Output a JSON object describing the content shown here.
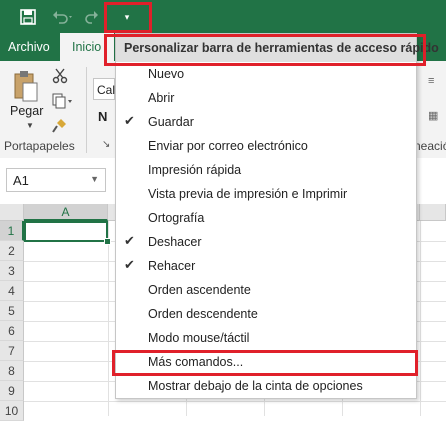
{
  "qat": {
    "save_icon": "save-icon",
    "undo_icon": "undo-icon",
    "redo_icon": "redo-icon",
    "customize_icon": "customize-qat-icon",
    "customize_glyph": "▾"
  },
  "tabs": {
    "archivo": "Archivo",
    "inicio": "Inicio"
  },
  "ribbon": {
    "paste_label": "Pegar",
    "clipboard_group": "Portapapeles",
    "font_box": "Cal",
    "bold": "N",
    "right_group_partial": "neació"
  },
  "formula": {
    "name_box": "A1"
  },
  "grid": {
    "columns": [
      "A",
      "",
      "",
      "",
      "",
      ""
    ],
    "rows": [
      "1",
      "2",
      "3",
      "4",
      "5",
      "6",
      "7",
      "8",
      "9",
      "10"
    ]
  },
  "menu": {
    "title": "Personalizar barra de herramientas de acceso rápido",
    "items": [
      {
        "label": "Nuevo",
        "checked": false
      },
      {
        "label": "Abrir",
        "checked": false
      },
      {
        "label": "Guardar",
        "checked": true
      },
      {
        "label": "Enviar por correo electrónico",
        "checked": false
      },
      {
        "label": "Impresión rápida",
        "checked": false
      },
      {
        "label": "Vista previa de impresión e Imprimir",
        "checked": false
      },
      {
        "label": "Ortografía",
        "checked": false
      },
      {
        "label": "Deshacer",
        "checked": true
      },
      {
        "label": "Rehacer",
        "checked": true
      },
      {
        "label": "Orden ascendente",
        "checked": false
      },
      {
        "label": "Orden descendente",
        "checked": false
      },
      {
        "label": "Modo mouse/táctil",
        "checked": false
      },
      {
        "label": "Más comandos...",
        "checked": false
      },
      {
        "label": "Mostrar debajo de la cinta de opciones",
        "checked": false
      }
    ],
    "check_glyph": "✔"
  },
  "colors": {
    "brand": "#217346",
    "highlight": "#e0202a"
  }
}
